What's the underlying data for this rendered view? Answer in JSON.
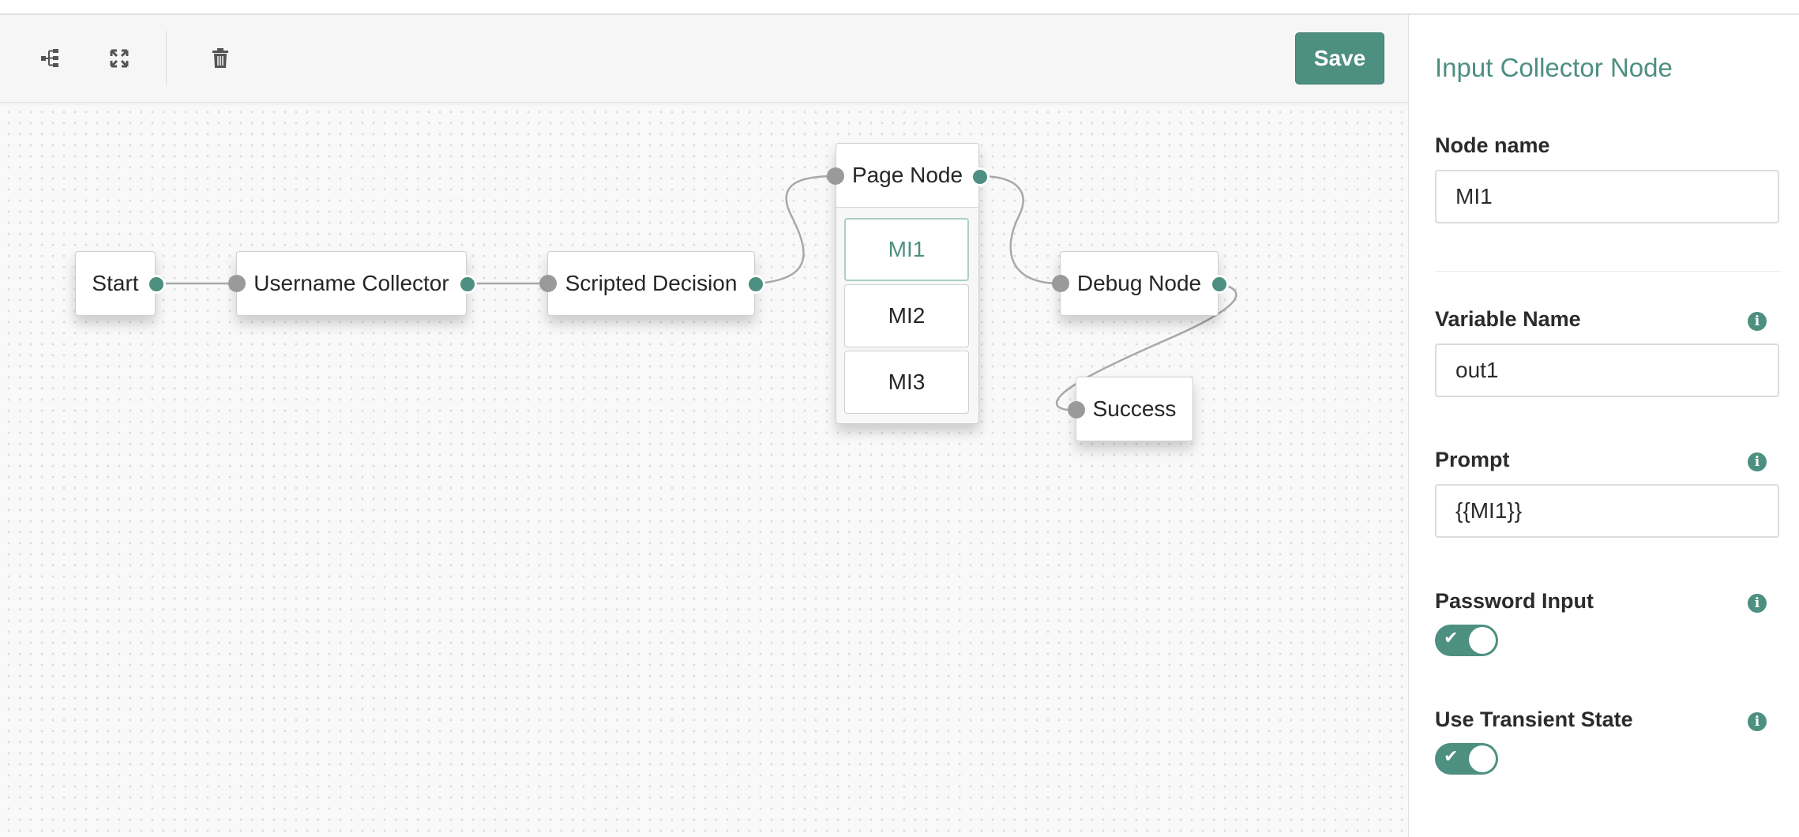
{
  "toolbar": {
    "icons": [
      "tree-layout-icon",
      "fullscreen-icon",
      "trash-icon"
    ],
    "save_label": "Save"
  },
  "canvas": {
    "nodes": {
      "start": "Start",
      "username_collector": "Username Collector",
      "scripted_decision": "Scripted Decision",
      "page_node": "Page Node",
      "debug_node": "Debug Node",
      "success": "Success"
    },
    "page_children": [
      "MI1",
      "MI2",
      "MI3"
    ],
    "selected_child": "MI1"
  },
  "panel": {
    "title": "Input Collector Node",
    "node_name_label": "Node name",
    "node_name_value": "MI1",
    "variable_name_label": "Variable Name",
    "variable_name_value": "out1",
    "prompt_label": "Prompt",
    "prompt_value": "{{MI1}}",
    "password_input_label": "Password Input",
    "password_input_on": true,
    "transient_state_label": "Use Transient State",
    "transient_state_on": true
  },
  "colors": {
    "accent": "#4d8f80",
    "port_in": "#9a9a9a",
    "edge": "#a8a8a8"
  }
}
